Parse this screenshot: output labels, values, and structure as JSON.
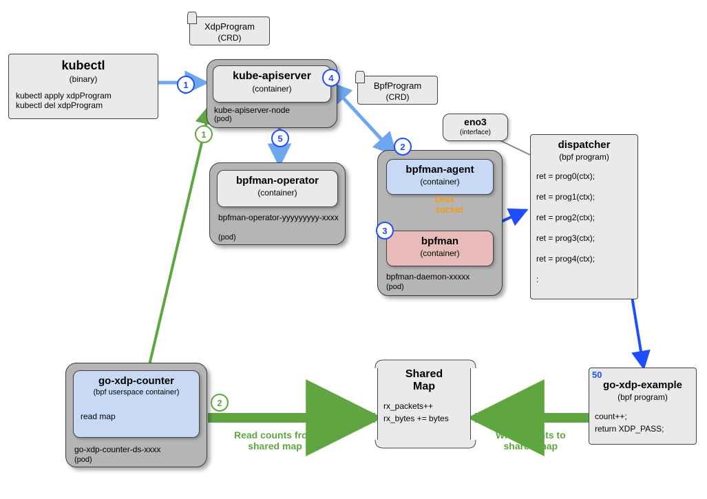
{
  "nodes": {
    "kubectl": {
      "title": "kubectl",
      "subtitle": "(binary)",
      "cmd1": "kubectl apply xdpProgram",
      "cmd2": "kubectl del xdpProgram"
    },
    "xdpprogram_crd": {
      "title": "XdpProgram",
      "subtitle": "(CRD)"
    },
    "bpfprogram_crd": {
      "title": "BpfProgram",
      "subtitle": "(CRD)"
    },
    "kube_apiserver": {
      "title": "kube-apiserver",
      "subtitle": "(container)"
    },
    "kube_apiserver_pod": {
      "label": "kube-apiserver-node",
      "sublabel": "(pod)"
    },
    "bpfman_operator": {
      "title": "bpfman-operator",
      "subtitle": "(container)"
    },
    "bpfman_operator_pod": {
      "label": "bpfman-operator-yyyyyyyyy-xxxx",
      "sublabel": "(pod)"
    },
    "bpfman_agent": {
      "title": "bpfman-agent",
      "subtitle": "(container)"
    },
    "bpfman": {
      "title": "bpfman",
      "subtitle": "(container)"
    },
    "bpfman_daemon_pod": {
      "label": "bpfman-daemon-xxxxx",
      "sublabel": "(pod)"
    },
    "eno3": {
      "title": "eno3",
      "subtitle": "(interface)"
    },
    "dispatcher": {
      "title": "dispatcher",
      "subtitle": "(bpf program)",
      "lines": [
        "ret = prog0(ctx);",
        "ret = prog1(ctx);",
        "ret = prog2(ctx);",
        "ret = prog3(ctx);",
        "ret = prog4(ctx);",
        ":"
      ]
    },
    "go_xdp_counter": {
      "title": "go-xdp-counter",
      "subtitle": "(bpf userspace container)",
      "body": "read map"
    },
    "go_xdp_counter_pod": {
      "label": "go-xdp-counter-ds-xxxx",
      "sublabel": "(pod)"
    },
    "shared_map": {
      "title": "Shared\nMap",
      "body1": "rx_packets++",
      "body2": "rx_bytes += bytes"
    },
    "go_xdp_example": {
      "title": "go-xdp-example",
      "subtitle": "(bpf program)",
      "priority": "50",
      "body1": "count++;",
      "body2": "return XDP_PASS;"
    }
  },
  "steps": {
    "s1": "1",
    "s2": "2",
    "s3": "3",
    "s4": "4",
    "s5": "5",
    "g1": "1",
    "g2": "2"
  },
  "labels": {
    "unix_socket": "Unix\nsocket",
    "read_counts": "Read counts from\nshared map",
    "write_counts": "Write counts to\nshared map"
  }
}
